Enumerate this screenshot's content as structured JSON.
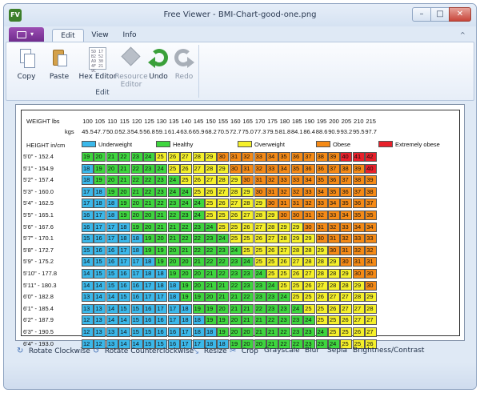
{
  "window": {
    "title": "Free Viewer - BMI-Chart-good-one.png",
    "app_icon": "FV"
  },
  "window_controls": {
    "minimize": "–",
    "maximize": "□",
    "close": "✕"
  },
  "tabs": {
    "edit": "Edit",
    "view": "View",
    "info": "Info"
  },
  "ribbon": {
    "group_label": "Edit",
    "buttons": {
      "copy": "Copy",
      "paste": "Paste",
      "hex_editor": "Hex Editor",
      "resource_editor_1": "Resource",
      "resource_editor_2": "Editor",
      "undo": "Undo",
      "redo": "Redo"
    },
    "hex_icon_text": "5D 17 B2\n52 A9 30\n4F 21 9C"
  },
  "chart_data": {
    "type": "table",
    "weight_label": "WEIGHT  lbs",
    "kgs_label": "kgs",
    "height_label": "HEIGHT  in/cm",
    "lbs": [
      100,
      105,
      110,
      115,
      120,
      125,
      130,
      135,
      140,
      145,
      150,
      155,
      160,
      165,
      170,
      175,
      180,
      185,
      190,
      195,
      200,
      205,
      210,
      215
    ],
    "kgs": [
      "45.5",
      "47.7",
      "50.0",
      "52.3",
      "54.5",
      "56.8",
      "59.1",
      "61.4",
      "63.6",
      "65.9",
      "68.2",
      "70.5",
      "72.7",
      "75.0",
      "77.3",
      "79.5",
      "81.8",
      "84.1",
      "86.4",
      "88.6",
      "90.9",
      "93.2",
      "95.5",
      "97.7"
    ],
    "legend": [
      {
        "label": "Underweight",
        "color": "#3bb8ea"
      },
      {
        "label": "Healthy",
        "color": "#3ed63e"
      },
      {
        "label": "Overweight",
        "color": "#f5f02a"
      },
      {
        "label": "Obese",
        "color": "#f58a16"
      },
      {
        "label": "Extremely obese",
        "color": "#e8202a"
      }
    ],
    "heights": [
      "5'0\" - 152.4",
      "5'1\" - 154.9",
      "5'2\" - 157.4",
      "5'3\" - 160.0",
      "5'4\" - 162.5",
      "5'5\" - 165.1",
      "5'6\" - 167.6",
      "5'7\" - 170.1",
      "5'8\" - 172.7",
      "5'9\" - 175.2",
      "5'10\" - 177.8",
      "5'11\" - 180.3",
      "6'0\" - 182.8",
      "6'1\" - 185.4",
      "6'2\" - 187.9",
      "6'3\" - 190.5",
      "6'4\" - 193.0"
    ],
    "bmi": [
      [
        19,
        20,
        21,
        22,
        23,
        24,
        25,
        26,
        27,
        28,
        29,
        30,
        31,
        32,
        33,
        34,
        35,
        36,
        37,
        38,
        39,
        40,
        41,
        42
      ],
      [
        18,
        19,
        20,
        21,
        22,
        23,
        24,
        25,
        26,
        27,
        28,
        29,
        30,
        31,
        32,
        33,
        34,
        35,
        36,
        36,
        37,
        38,
        39,
        40
      ],
      [
        18,
        19,
        20,
        21,
        22,
        22,
        23,
        24,
        25,
        26,
        27,
        28,
        29,
        30,
        31,
        32,
        33,
        33,
        34,
        35,
        36,
        37,
        38,
        39
      ],
      [
        17,
        18,
        19,
        20,
        21,
        22,
        23,
        24,
        24,
        25,
        26,
        27,
        28,
        29,
        30,
        31,
        32,
        32,
        33,
        34,
        35,
        36,
        37,
        38
      ],
      [
        17,
        18,
        18,
        19,
        20,
        21,
        22,
        23,
        24,
        24,
        25,
        26,
        27,
        28,
        29,
        30,
        31,
        31,
        32,
        33,
        34,
        35,
        36,
        37
      ],
      [
        16,
        17,
        18,
        19,
        20,
        20,
        21,
        22,
        23,
        24,
        25,
        25,
        26,
        27,
        28,
        29,
        30,
        30,
        31,
        32,
        33,
        34,
        35,
        35
      ],
      [
        16,
        17,
        17,
        18,
        19,
        20,
        21,
        21,
        22,
        23,
        24,
        25,
        25,
        26,
        27,
        28,
        29,
        29,
        30,
        31,
        32,
        33,
        34,
        34
      ],
      [
        15,
        16,
        17,
        18,
        18,
        19,
        20,
        21,
        22,
        22,
        23,
        24,
        25,
        25,
        26,
        27,
        28,
        29,
        29,
        30,
        31,
        32,
        33,
        33
      ],
      [
        15,
        16,
        16,
        17,
        18,
        19,
        19,
        20,
        21,
        22,
        22,
        23,
        24,
        25,
        25,
        26,
        27,
        28,
        28,
        29,
        30,
        31,
        32,
        32
      ],
      [
        14,
        15,
        16,
        17,
        17,
        18,
        19,
        20,
        20,
        21,
        22,
        22,
        23,
        24,
        25,
        25,
        26,
        27,
        28,
        28,
        29,
        30,
        31,
        31
      ],
      [
        14,
        15,
        15,
        16,
        17,
        18,
        18,
        19,
        20,
        20,
        21,
        22,
        23,
        23,
        24,
        25,
        25,
        26,
        27,
        28,
        28,
        29,
        30,
        30
      ],
      [
        14,
        14,
        15,
        16,
        16,
        17,
        18,
        18,
        19,
        20,
        21,
        21,
        22,
        23,
        23,
        24,
        25,
        25,
        26,
        27,
        28,
        28,
        29,
        30
      ],
      [
        13,
        14,
        14,
        15,
        16,
        17,
        17,
        18,
        19,
        19,
        20,
        21,
        21,
        22,
        23,
        23,
        24,
        25,
        25,
        26,
        27,
        27,
        28,
        29
      ],
      [
        13,
        13,
        14,
        15,
        15,
        16,
        17,
        17,
        18,
        19,
        19,
        20,
        21,
        21,
        22,
        23,
        23,
        24,
        25,
        25,
        26,
        27,
        27,
        28
      ],
      [
        12,
        13,
        14,
        14,
        15,
        16,
        16,
        17,
        18,
        18,
        19,
        19,
        20,
        21,
        21,
        22,
        23,
        23,
        24,
        25,
        25,
        26,
        27,
        27
      ],
      [
        12,
        13,
        13,
        14,
        15,
        15,
        16,
        16,
        17,
        18,
        18,
        19,
        20,
        20,
        21,
        21,
        22,
        23,
        23,
        24,
        25,
        25,
        26,
        27
      ],
      [
        12,
        12,
        13,
        14,
        14,
        15,
        15,
        16,
        17,
        17,
        18,
        18,
        19,
        20,
        20,
        21,
        22,
        22,
        23,
        23,
        24,
        25,
        25,
        26
      ]
    ]
  },
  "toolbar": {
    "rotate_cw": "Rotate Clockwise",
    "rotate_ccw": "Rotate Counterclockwise",
    "resize": "Resize",
    "crop": "Crop",
    "grayscale": "Grayscale",
    "blur": "Blur",
    "sepia": "Sepia",
    "brightness": "Brightness/Contrast"
  }
}
